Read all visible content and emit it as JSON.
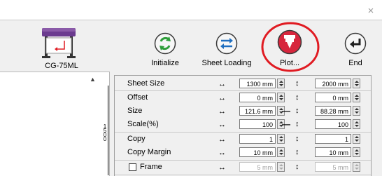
{
  "window": {
    "close_glyph": "×"
  },
  "device": {
    "name": "CG-75ML"
  },
  "toolbar": {
    "initialize_label": "Initialize",
    "sheet_loading_label": "Sheet Loading",
    "plot_label": "Plot...",
    "end_label": "End"
  },
  "ruler": {
    "digits": "1\n5\n0\n0"
  },
  "settings": {
    "rows": [
      {
        "label": "Sheet Size",
        "x_value": "1300 mm",
        "y_value": "2000 mm",
        "linked": false,
        "enabled": true
      },
      {
        "label": "Offset",
        "x_value": "0 mm",
        "y_value": "0 mm",
        "linked": false,
        "enabled": true
      },
      {
        "label": "Size",
        "x_value": "121.6 mm",
        "y_value": "88.28 mm",
        "linked": true,
        "enabled": true
      },
      {
        "label": "Scale(%)",
        "x_value": "100",
        "y_value": "100",
        "linked": true,
        "enabled": true
      },
      {
        "label": "Copy",
        "x_value": "1",
        "y_value": "1",
        "linked": false,
        "enabled": true
      },
      {
        "label": "Copy Margin",
        "x_value": "10 mm",
        "y_value": "10 mm",
        "linked": false,
        "enabled": true
      },
      {
        "label": "Frame",
        "x_value": "5 mm",
        "y_value": "5 mm",
        "linked": false,
        "enabled": false
      }
    ],
    "horizontal_glyph": "↔",
    "vertical_glyph": "↕",
    "link_glyph": "—"
  },
  "colors": {
    "accent_green": "#2e9e3a",
    "accent_blue": "#1f6fc0",
    "accent_red": "#d7263d",
    "highlight_ring": "#e01b22"
  }
}
